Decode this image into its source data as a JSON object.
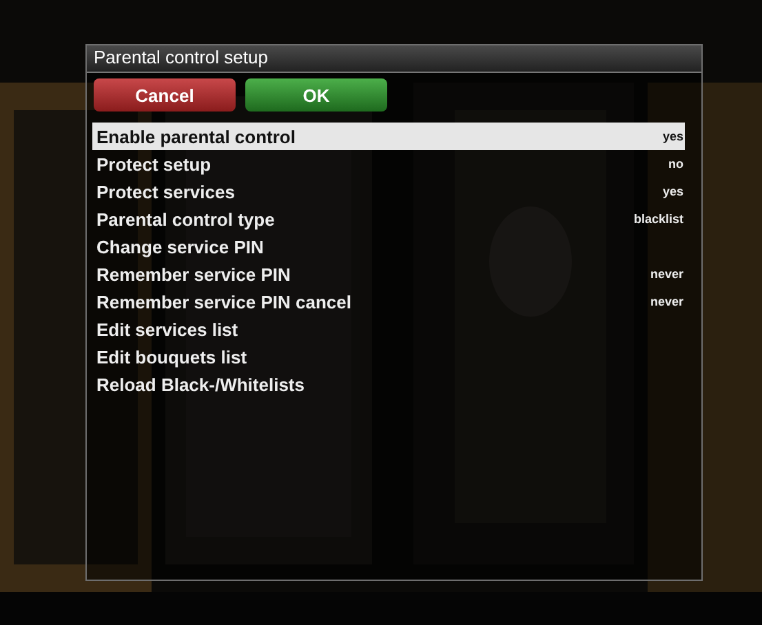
{
  "dialog": {
    "title": "Parental control setup"
  },
  "buttons": [
    {
      "label": "Cancel",
      "kind": "cancel"
    },
    {
      "label": "OK",
      "kind": "ok"
    }
  ],
  "settings": [
    {
      "label": "Enable parental control",
      "value": "yes",
      "selected": true
    },
    {
      "label": "Protect setup",
      "value": "no",
      "selected": false
    },
    {
      "label": "Protect services",
      "value": "yes",
      "selected": false
    },
    {
      "label": "Parental control type",
      "value": "blacklist",
      "selected": false
    },
    {
      "label": "Change service PIN",
      "selected": false
    },
    {
      "label": "Remember service PIN",
      "value": "never",
      "selected": false
    },
    {
      "label": "Remember service PIN cancel",
      "value": "never",
      "selected": false
    },
    {
      "label": "Edit services list",
      "selected": false
    },
    {
      "label": "Edit bouquets list",
      "selected": false
    },
    {
      "label": "Reload Black-/Whitelists",
      "selected": false
    }
  ]
}
